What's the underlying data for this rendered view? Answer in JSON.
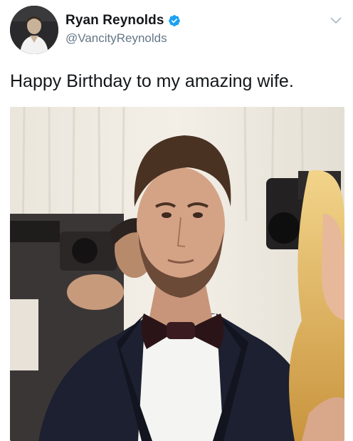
{
  "tweet": {
    "author": {
      "display_name": "Ryan Reynolds",
      "handle": "@VancityReynolds",
      "verified": true
    },
    "text": "Happy Birthday to my amazing wife.",
    "icons": {
      "verified": "verified-badge-icon",
      "menu": "chevron-down-icon"
    },
    "colors": {
      "verified_blue": "#1da1f2",
      "handle_gray": "#657786",
      "text": "#14171a"
    }
  }
}
